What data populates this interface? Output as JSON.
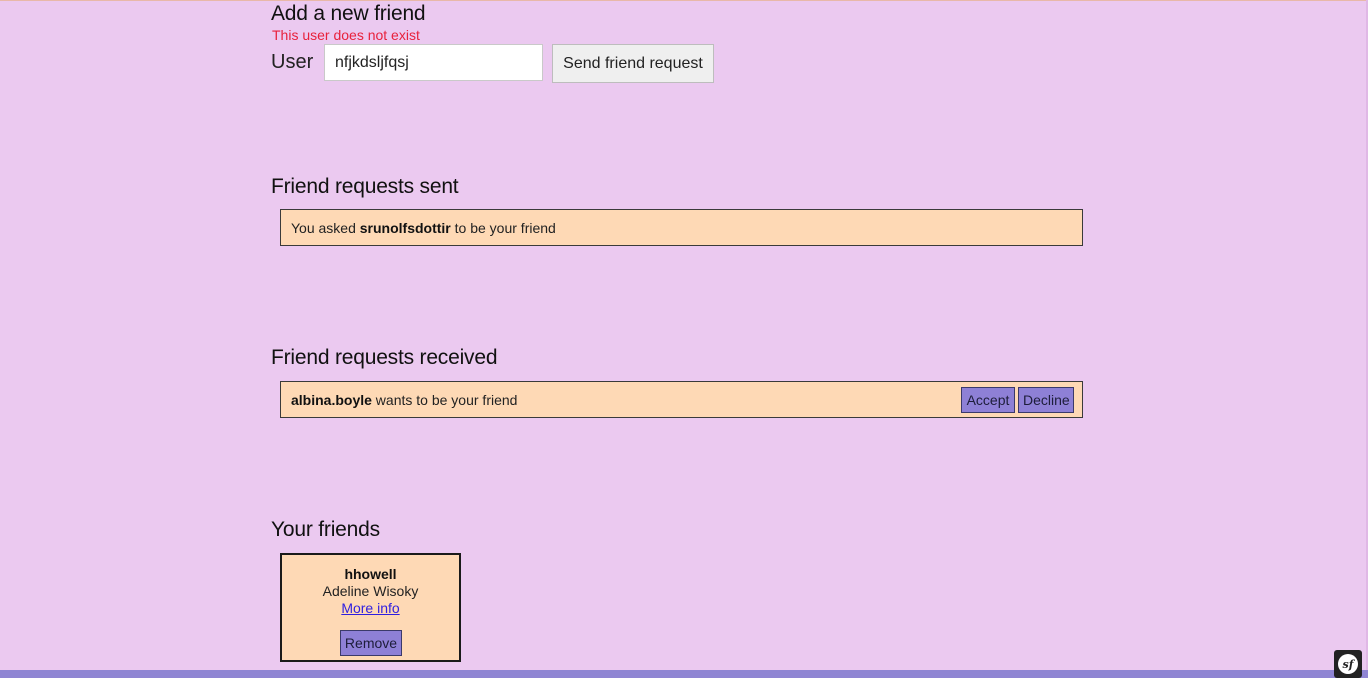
{
  "add_friend": {
    "title": "Add a new friend",
    "error": "This user does not exist",
    "user_label": "User",
    "user_value": "nfjkdsljfqsj",
    "send_button": "Send friend request"
  },
  "requests_sent": {
    "title": "Friend requests sent",
    "items": [
      {
        "prefix": "You asked ",
        "username": "srunolfsdottir",
        "suffix": " to be your friend"
      }
    ]
  },
  "requests_received": {
    "title": "Friend requests received",
    "items": [
      {
        "username": "albina.boyle",
        "suffix": " wants to be your friend",
        "accept": "Accept",
        "decline": "Decline"
      }
    ]
  },
  "friends": {
    "title": "Your friends",
    "items": [
      {
        "username": "hhowell",
        "full_name": "Adeline Wisoky",
        "more_info": "More info",
        "remove": "Remove"
      }
    ]
  },
  "toolbar": {
    "icon": "symfony-icon"
  },
  "colors": {
    "background": "#ebc9f0",
    "card": "#fed9b5",
    "button": "#8e80d6",
    "error": "#e8213c",
    "link": "#2f1fe0",
    "footer": "#8f85d3"
  }
}
